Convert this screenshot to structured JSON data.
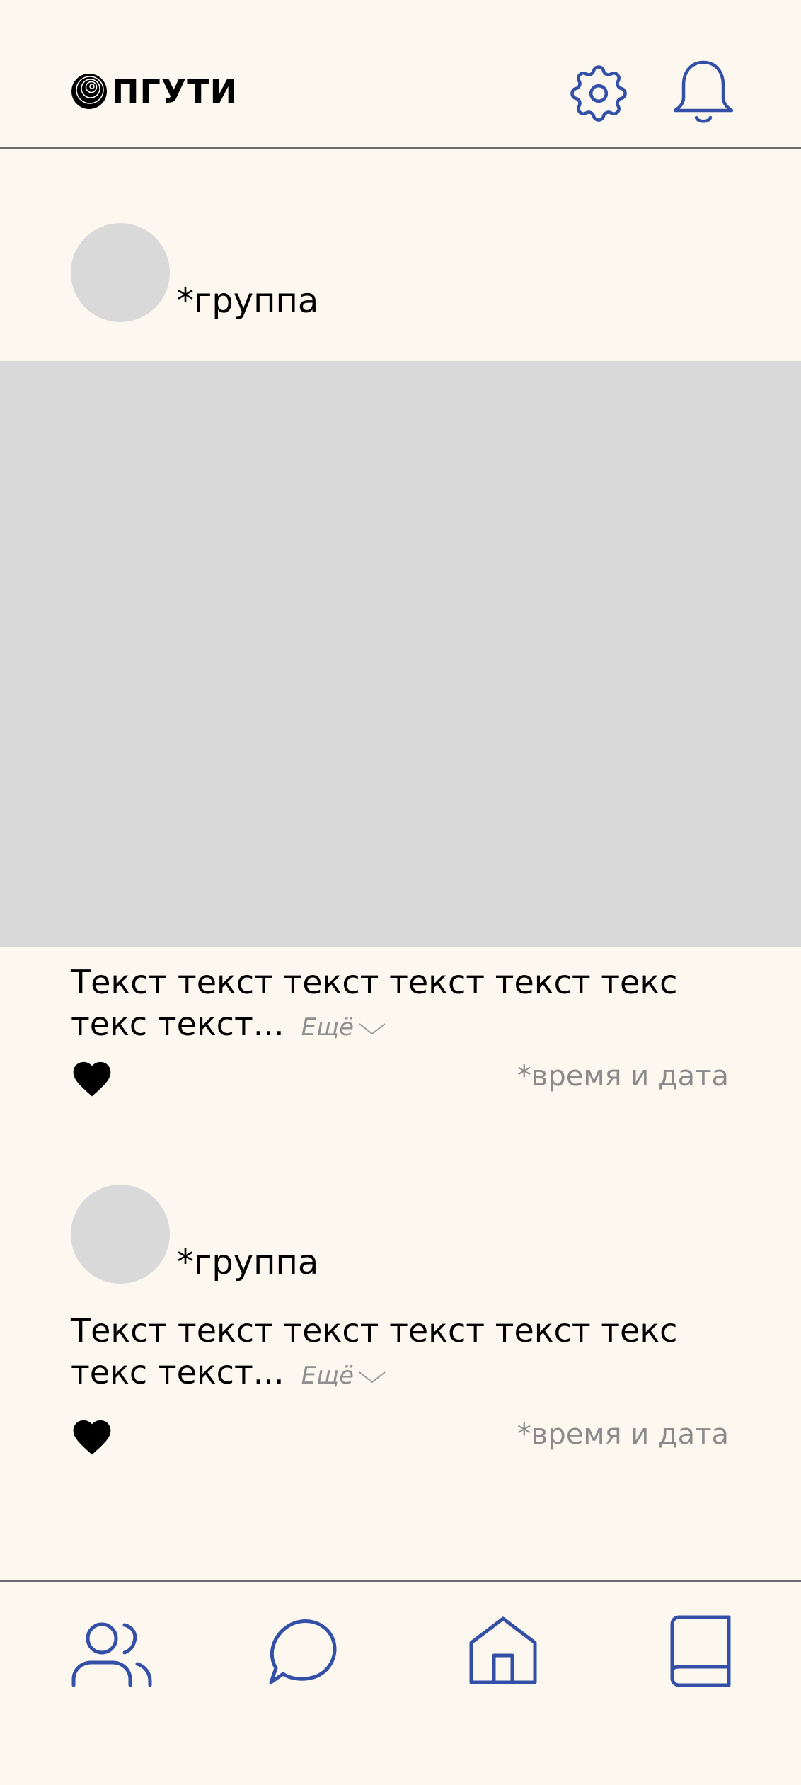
{
  "header": {
    "logo_text": "ПГУТИ",
    "logo_icon": "concentric-circles-logo",
    "settings_icon": "gear-icon",
    "notifications_icon": "bell-icon"
  },
  "posts": [
    {
      "group": "*группа",
      "has_image": true,
      "text": "Текст текст текст текст текст текс текс текст...",
      "more_label": "Ещё",
      "like_icon": "heart-icon",
      "time": "*время и дата"
    },
    {
      "group": "*группа",
      "has_image": false,
      "text": "Текст текст текст текст текст текс текс текст...",
      "more_label": "Ещё",
      "like_icon": "heart-icon",
      "time": "*время и дата"
    }
  ],
  "bottom_nav": [
    {
      "icon": "users-icon"
    },
    {
      "icon": "chat-icon"
    },
    {
      "icon": "home-icon"
    },
    {
      "icon": "book-icon"
    }
  ],
  "colors": {
    "background": "#fdf8ef",
    "accent": "#3450a6",
    "placeholder": "#d9d9d9",
    "muted_text": "#8a8a8a"
  }
}
